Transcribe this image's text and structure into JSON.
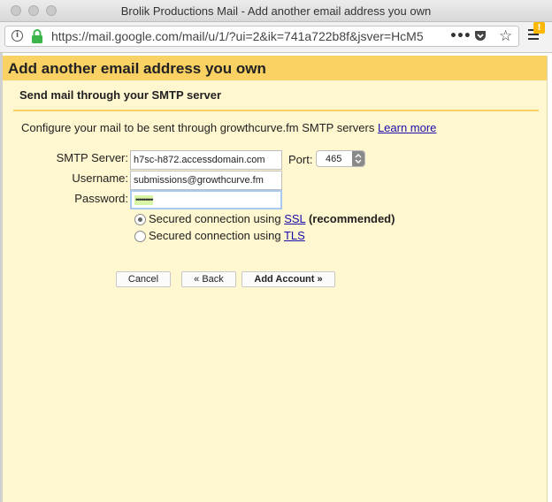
{
  "window": {
    "title": "Brolik Productions Mail - Add another email address you own"
  },
  "browser": {
    "url": "https://mail.google.com/mail/u/1/?ui=2&ik=741a722b8f&jsver=HcM5",
    "more_glyph": "•••",
    "star_glyph": "☆",
    "badge_glyph": "!"
  },
  "dialog": {
    "title": "Add another email address you own",
    "section_title": "Send mail through your SMTP server",
    "description": "Configure your mail to be sent through growthcurve.fm SMTP servers ",
    "learn_more": "Learn more",
    "smtp_label": "SMTP Server:",
    "smtp_value": "h7sc-h872.accessdomain.com",
    "port_label": "Port:",
    "port_value": "465",
    "username_label": "Username:",
    "username_value": "submissions@growthcurve.fm",
    "password_label": "Password:",
    "password_value": "•••••••••",
    "ssl_text": "Secured connection using ",
    "ssl_link": "SSL",
    "ssl_note": "(recommended)",
    "tls_text": "Secured connection using ",
    "tls_link": "TLS",
    "cancel_label": "Cancel",
    "back_label": "« Back",
    "add_label": "Add Account »"
  },
  "colors": {
    "header": "#fad163",
    "dialog_bg": "#fff7cf",
    "link": "#1a0dab",
    "lock": "#3bb54a",
    "password_highlight": "#d8f5a6"
  }
}
